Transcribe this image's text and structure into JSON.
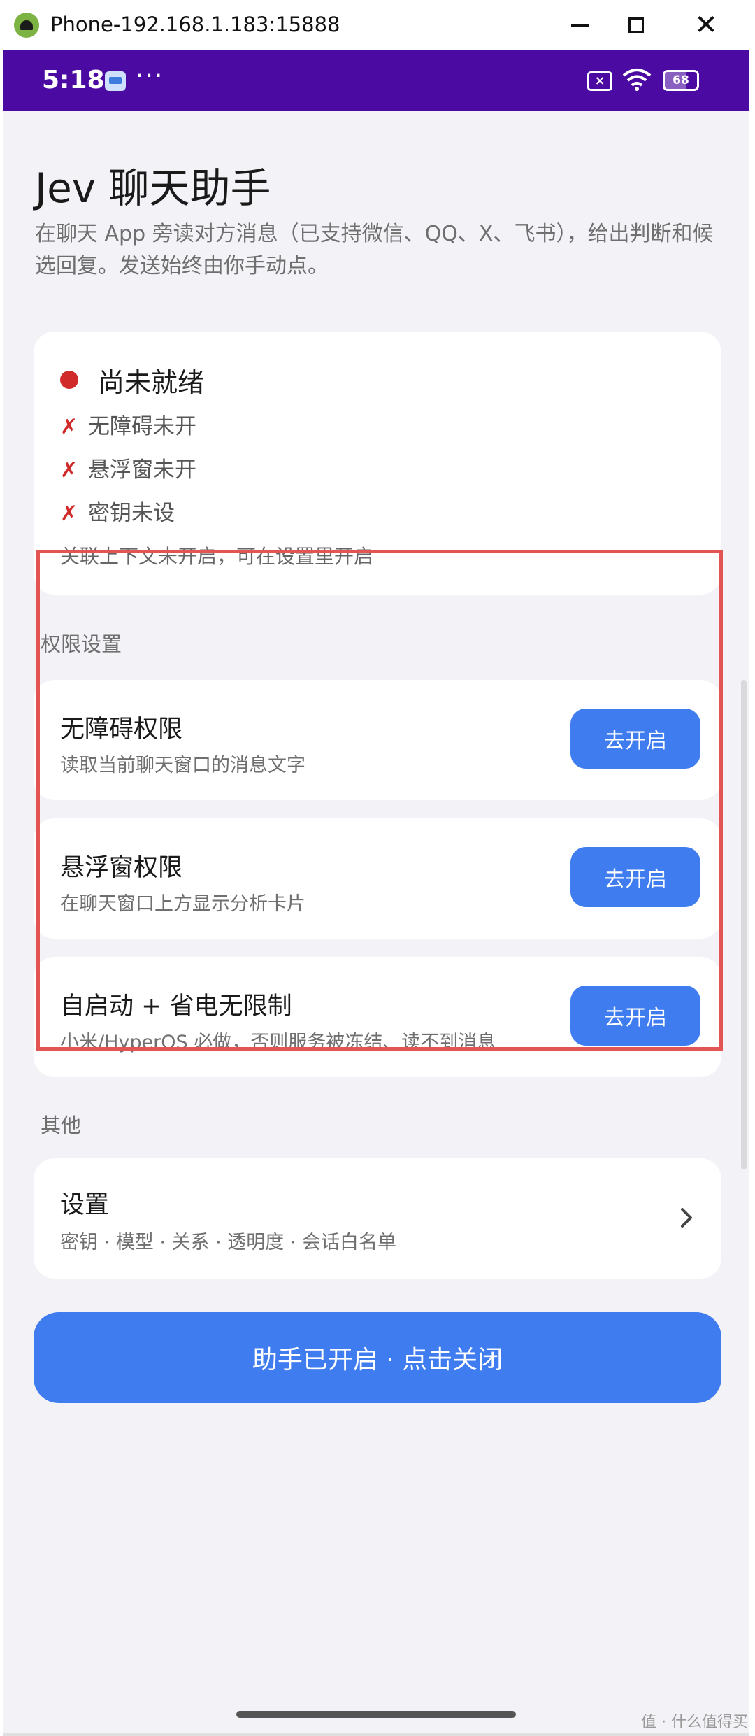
{
  "window": {
    "title": "Phone-192.168.1.183:15888",
    "icon": "android-icon",
    "controls": [
      "minimize-icon",
      "maximize-icon",
      "close-icon"
    ],
    "close_glyph": "✕"
  },
  "statusbar": {
    "time": "5:18",
    "overflow": "···",
    "battery_level": 68,
    "battery_text": "68",
    "background": "#4b0aa1"
  },
  "app": {
    "title": "Jev 聊天助手",
    "subtitle": "在聊天 App 旁读对方消息（已支持微信、QQ、X、飞书），给出判断和候选回复。发送始终由你手动点。"
  },
  "status_card": {
    "heading": "尚未就绪",
    "dot_color": "#d12a2a",
    "checks": [
      {
        "mark": "✗",
        "label": "无障碍未开"
      },
      {
        "mark": "✗",
        "label": "悬浮窗未开"
      },
      {
        "mark": "✗",
        "label": "密钥未设"
      }
    ],
    "note": "关联上下文未开启，可在设置里开启"
  },
  "permissions": {
    "section_label": "权限设置",
    "items": [
      {
        "title": "无障碍权限",
        "desc": "读取当前聊天窗口的消息文字",
        "button": "去开启"
      },
      {
        "title": "悬浮窗权限",
        "desc": "在聊天窗口上方显示分析卡片",
        "button": "去开启"
      },
      {
        "title": "自启动 + 省电无限制",
        "desc": "小米/HyperOS 必做，否则服务被冻结、读不到消息",
        "button": "去开启"
      }
    ]
  },
  "other": {
    "section_label": "其他",
    "settings_title": "设置",
    "settings_desc": "密钥 · 模型 · 关系 · 透明度 · 会话白名单"
  },
  "main_toggle": {
    "label": "助手已开启 · 点击关闭"
  },
  "watermark": "值 · 什么值得买",
  "colors": {
    "accent": "#3f7cf0",
    "highlight_border": "#e25552",
    "background": "#f3f2f7"
  }
}
